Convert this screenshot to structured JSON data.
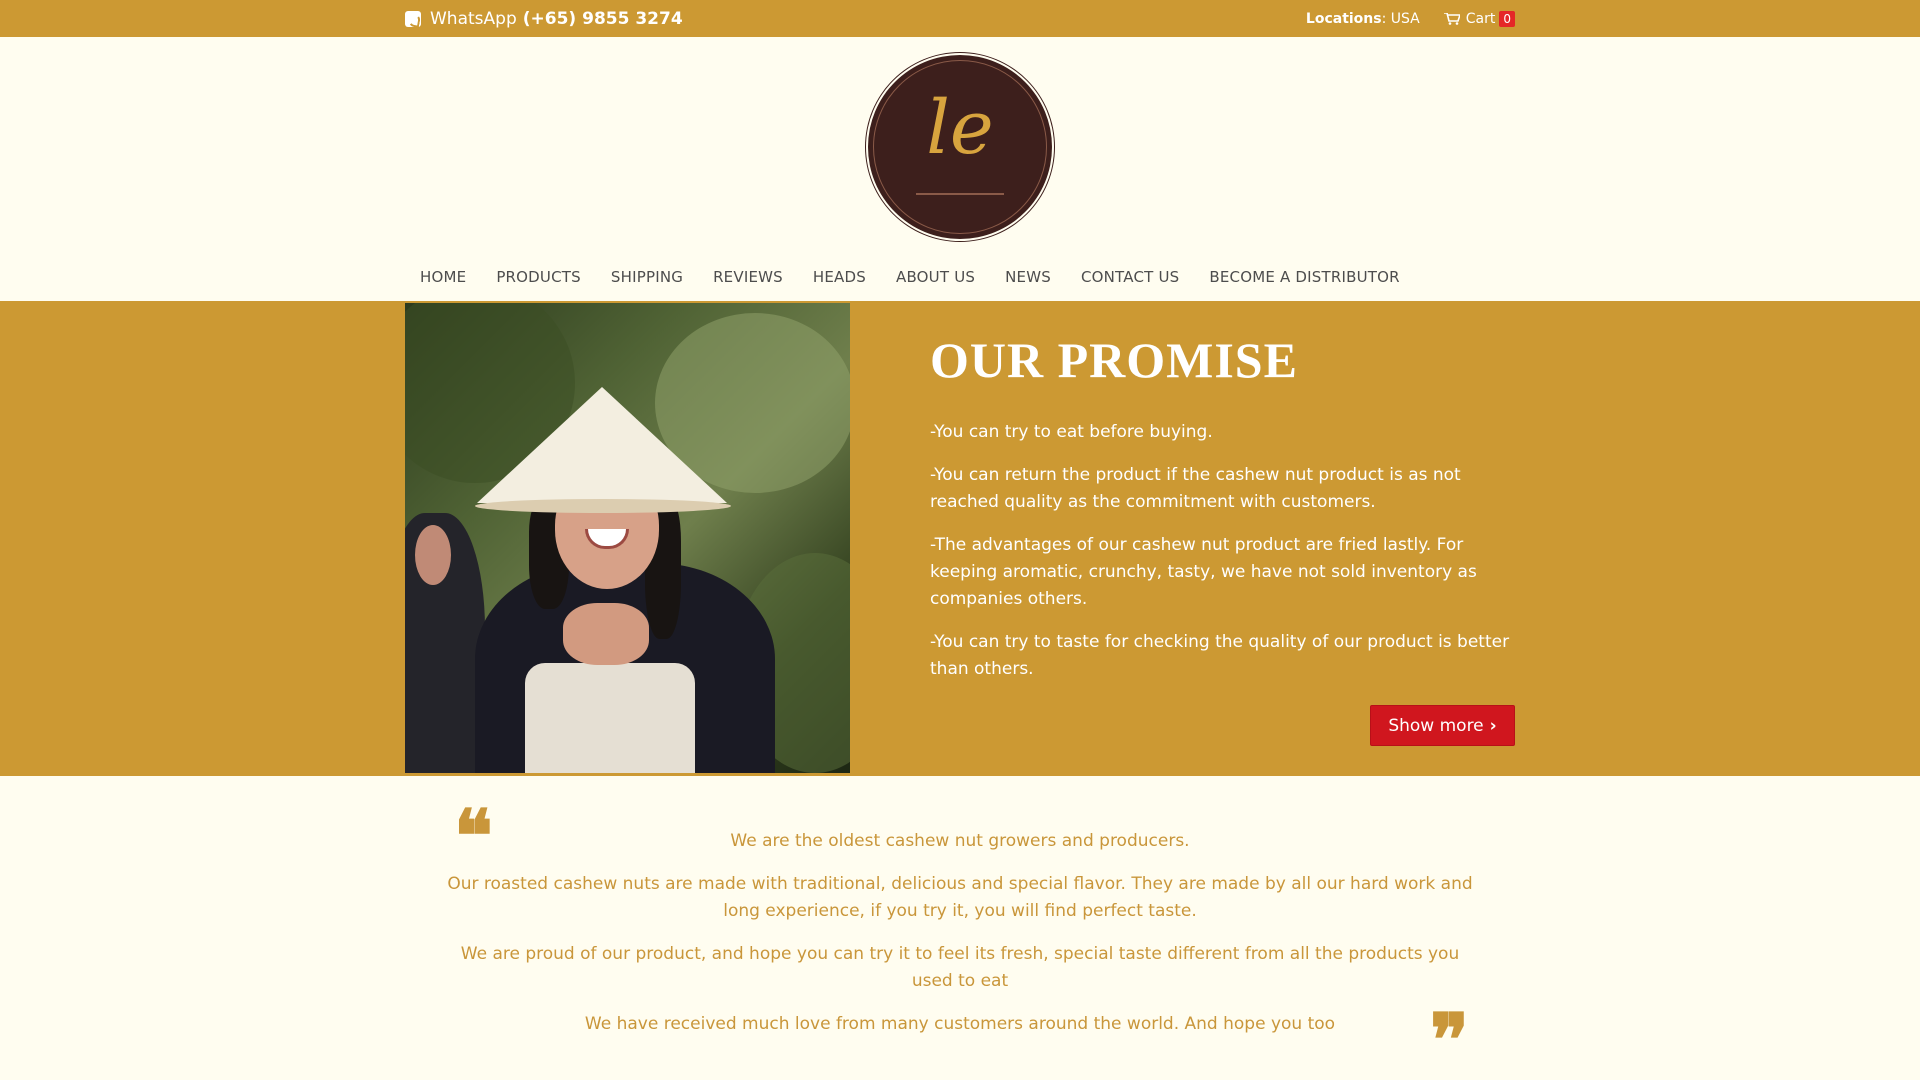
{
  "topbar": {
    "whatsapp_label": "WhatsApp",
    "whatsapp_number": "(+65) 9855 3274",
    "locations_label": "Locations",
    "locations_value": ": USA",
    "cart_label": "Cart",
    "cart_count": "0"
  },
  "logo": {
    "text": "le"
  },
  "nav": {
    "items": [
      {
        "label": "HOME"
      },
      {
        "label": "PRODUCTS"
      },
      {
        "label": "SHIPPING"
      },
      {
        "label": "REVIEWS"
      },
      {
        "label": "HEADS"
      },
      {
        "label": "ABOUT US"
      },
      {
        "label": "NEWS"
      },
      {
        "label": "CONTACT US"
      },
      {
        "label": "BECOME A DISTRIBUTOR"
      }
    ]
  },
  "promise": {
    "title": "OUR PROMISE",
    "items": [
      "-You can try to eat before buying.",
      "-You can return the product if the cashew nut product is as not reached quality as the commitment with customers.",
      "-The advantages of our cashew nut product are fried lastly. For keeping aromatic, crunchy, tasty, we have not sold inventory as companies others.",
      "-You can try to taste for checking the quality of our product is better than others."
    ],
    "button_label": "Show more",
    "button_chevron": "›"
  },
  "testimonial": {
    "open_quote": "❝",
    "close_quote": "❞",
    "lines": [
      "We are the oldest cashew nut growers and producers.",
      "Our roasted cashew nuts are made with traditional, delicious and special flavor. They are made by all our hard work and long experience, if you try it, you will find perfect taste.",
      "We are proud of our product, and hope you can try it to feel its fresh, special taste different from all the products you used to eat",
      "We have received much love from many customers around the world. And hope you too"
    ]
  },
  "colors": {
    "brand_gold": "#cc9933",
    "page_cream": "#fffdf0",
    "logo_brown": "#3d1f1c",
    "button_red": "#d0161e",
    "cart_badge_red": "#e52727"
  },
  "icons": {
    "whatsapp": "whatsapp-icon",
    "cart": "cart-icon",
    "quote_open": "quote-open-icon",
    "quote_close": "quote-close-icon"
  }
}
